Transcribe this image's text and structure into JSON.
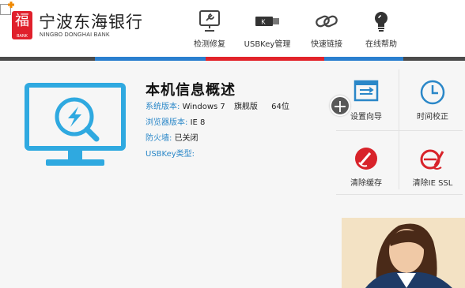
{
  "header": {
    "logo_cn": "宁波东海银行",
    "logo_en": "NINGBO DONGHAI BANK",
    "logo_mark": "福",
    "logo_mark_sub": "BANK"
  },
  "nav": [
    {
      "label": "检测修复",
      "icon": "monitor-wrench-icon"
    },
    {
      "label": "USBKey管理",
      "icon": "usbkey-icon"
    },
    {
      "label": "快速链接",
      "icon": "link-icon"
    },
    {
      "label": "在线帮助",
      "icon": "lightbulb-icon"
    }
  ],
  "colors": {
    "accent_blue": "#2a87c8",
    "monitor_blue": "#2fa9e0",
    "red": "#d8232a",
    "stripe": [
      "#4b4b4b",
      "#2a7fcf",
      "#e2232a",
      "#2a7fcf",
      "#4b4b4b"
    ]
  },
  "info": {
    "title": "本机信息概述",
    "os_label": "系统版本:",
    "os_value": "Windows 7",
    "os_edition": "旗舰版",
    "os_bits": "64位",
    "browser_label": "浏览器版本:",
    "browser_value": "IE 8",
    "firewall_label": "防火墙:",
    "firewall_value": "已关闭",
    "usbkey_label": "USBKey类型:",
    "usbkey_value": ""
  },
  "tools": [
    {
      "label": "设置向导",
      "icon": "wizard-icon"
    },
    {
      "label": "时间校正",
      "icon": "clock-icon"
    },
    {
      "label": "清除缓存",
      "icon": "clear-cache-icon"
    },
    {
      "label": "清除IE SSL",
      "icon": "clear-ssl-icon"
    }
  ],
  "plus_label": "+"
}
